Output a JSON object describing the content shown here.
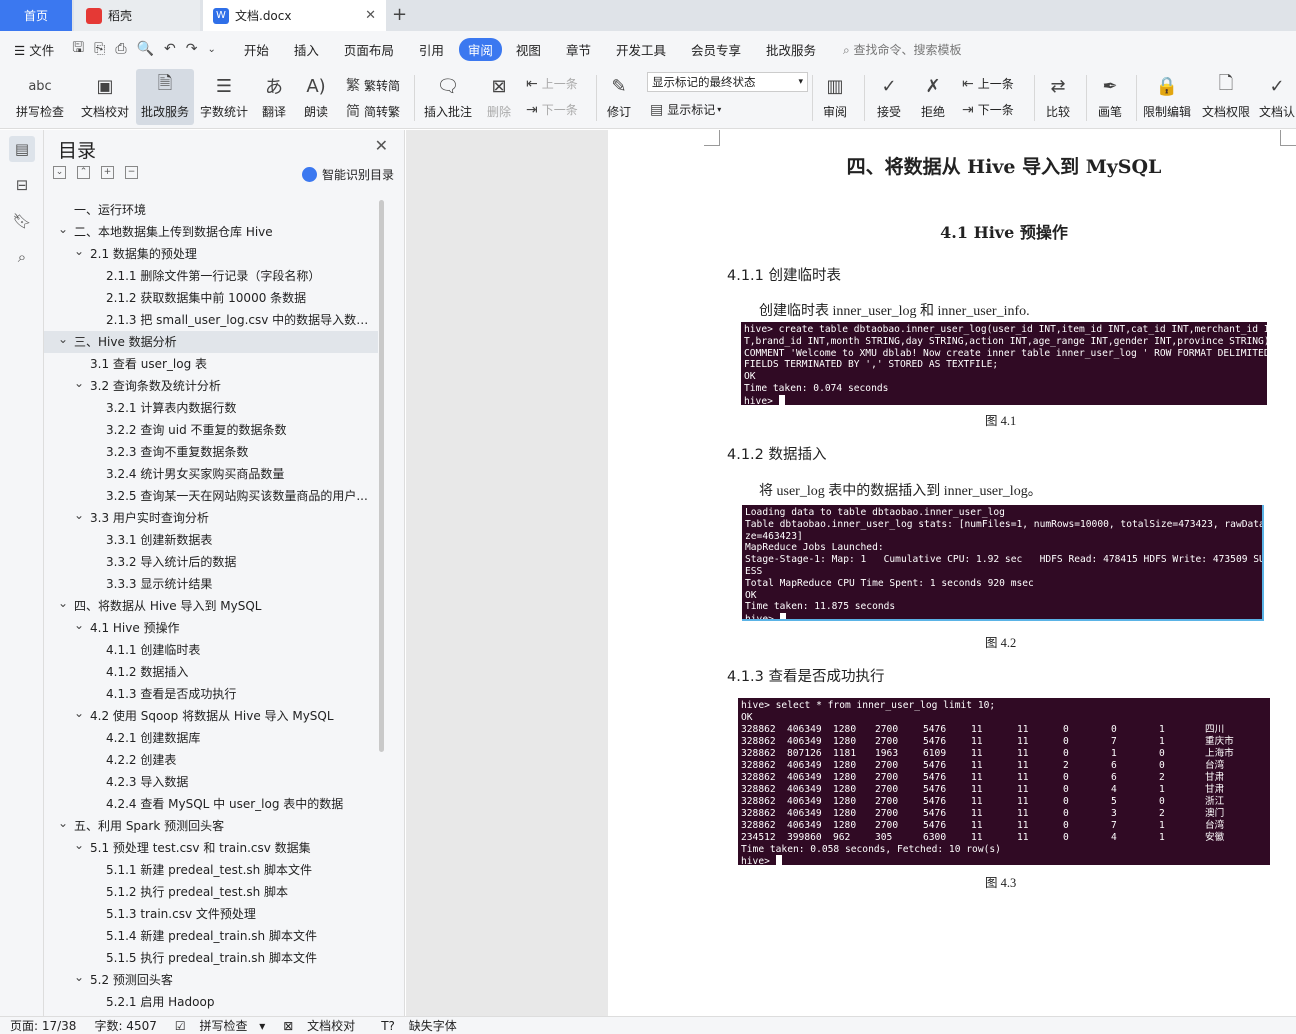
{
  "tabs": [
    {
      "label": "首页"
    },
    {
      "label": "稻壳"
    },
    {
      "label": "文档.docx"
    }
  ],
  "menu": {
    "file": "文件",
    "items": [
      "开始",
      "插入",
      "页面布局",
      "引用",
      "审阅",
      "视图",
      "章节",
      "开发工具",
      "会员专享",
      "批改服务"
    ],
    "active": "审阅",
    "search_placeholder": "查找命令、搜索模板"
  },
  "ribbon": {
    "spellcheck": "拼写检查",
    "doc_proof": "文档校对",
    "review_service": "批改服务",
    "word_count": "字数统计",
    "translate": "翻译",
    "read_aloud": "朗读",
    "to_traditional": "繁转简",
    "to_simplified": "简转繁",
    "insert_comment": "插入批注",
    "delete": "删除",
    "prev_top": "上一条",
    "next_top": "下一条",
    "track": "修订",
    "markup_state": "显示标记的最终状态",
    "show_markup": "显示标记",
    "review": "审阅",
    "accept": "接受",
    "reject": "拒绝",
    "prev": "上一条",
    "next": "下一条",
    "compare": "比较",
    "pen": "画笔",
    "restrict": "限制编辑",
    "doc_rights": "文档权限",
    "doc_cert": "文档认"
  },
  "toc": {
    "title": "目录",
    "smart": "智能识别目录",
    "items": [
      {
        "text": "一、运行环境",
        "level": 1,
        "toggle": ""
      },
      {
        "text": "二、本地数据集上传到数据仓库 Hive",
        "level": 1,
        "toggle": "v"
      },
      {
        "text": "2.1  数据集的预处理",
        "level": 2,
        "toggle": "v"
      },
      {
        "text": "2.1.1  删除文件第一行记录（字段名称）",
        "level": 3,
        "toggle": ""
      },
      {
        "text": "2.1.2  获取数据集中前 10000 条数据",
        "level": 3,
        "toggle": ""
      },
      {
        "text": "2.1.3  把 small_user_log.csv 中的数据导入数据...",
        "level": 3,
        "toggle": ""
      },
      {
        "text": "三、Hive 数据分析",
        "level": 1,
        "toggle": "v",
        "selected": true
      },
      {
        "text": "3.1  查看 user_log 表",
        "level": 2,
        "toggle": ""
      },
      {
        "text": "3.2  查询条数及统计分析",
        "level": 2,
        "toggle": "v"
      },
      {
        "text": "3.2.1  计算表内数据行数",
        "level": 3,
        "toggle": ""
      },
      {
        "text": "3.2.2  查询 uid 不重复的数据条数",
        "level": 3,
        "toggle": ""
      },
      {
        "text": "3.2.3  查询不重复数据条数",
        "level": 3,
        "toggle": ""
      },
      {
        "text": "3.2.4  统计男女买家购买商品数量",
        "level": 3,
        "toggle": ""
      },
      {
        "text": "3.2.5  查询某一天在网站购买该数量商品的用户...",
        "level": 3,
        "toggle": ""
      },
      {
        "text": "3.3  用户实时查询分析",
        "level": 2,
        "toggle": "v"
      },
      {
        "text": "3.3.1  创建新数据表",
        "level": 3,
        "toggle": ""
      },
      {
        "text": "3.3.2  导入统计后的数据",
        "level": 3,
        "toggle": ""
      },
      {
        "text": "3.3.3  显示统计结果",
        "level": 3,
        "toggle": ""
      },
      {
        "text": "四、将数据从 Hive 导入到 MySQL",
        "level": 1,
        "toggle": "v"
      },
      {
        "text": "4.1 Hive 预操作",
        "level": 2,
        "toggle": "v"
      },
      {
        "text": "4.1.1  创建临时表",
        "level": 3,
        "toggle": ""
      },
      {
        "text": "4.1.2  数据插入",
        "level": 3,
        "toggle": ""
      },
      {
        "text": "4.1.3  查看是否成功执行",
        "level": 3,
        "toggle": ""
      },
      {
        "text": "4.2  使用 Sqoop 将数据从 Hive 导入 MySQL",
        "level": 2,
        "toggle": "v"
      },
      {
        "text": "4.2.1  创建数据库",
        "level": 3,
        "toggle": ""
      },
      {
        "text": "4.2.2  创建表",
        "level": 3,
        "toggle": ""
      },
      {
        "text": "4.2.3  导入数据",
        "level": 3,
        "toggle": ""
      },
      {
        "text": "4.2.4  查看 MySQL 中 user_log 表中的数据",
        "level": 3,
        "toggle": ""
      },
      {
        "text": "五、利用 Spark 预测回头客",
        "level": 1,
        "toggle": "v"
      },
      {
        "text": "5.1  预处理 test.csv 和 train.csv 数据集",
        "level": 2,
        "toggle": "v"
      },
      {
        "text": "5.1.1  新建 predeal_test.sh 脚本文件",
        "level": 3,
        "toggle": ""
      },
      {
        "text": "5.1.2  执行 predeal_test.sh 脚本",
        "level": 3,
        "toggle": ""
      },
      {
        "text": "5.1.3 train.csv 文件预处理",
        "level": 3,
        "toggle": ""
      },
      {
        "text": "5.1.4  新建 predeal_train.sh 脚本文件",
        "level": 3,
        "toggle": ""
      },
      {
        "text": "5.1.5  执行 predeal_train.sh 脚本文件",
        "level": 3,
        "toggle": ""
      },
      {
        "text": "5.2  预测回头客",
        "level": 2,
        "toggle": "v"
      },
      {
        "text": "5.2.1  启用 Hadoop",
        "level": 3,
        "toggle": ""
      }
    ]
  },
  "doc": {
    "h1": "四、将数据从 Hive 导入到 MySQL",
    "h2": "4.1 Hive 预操作",
    "s1": "4.1.1  创建临时表",
    "p1": "创建临时表 inner_user_log 和 inner_user_info.",
    "term1": "hive> create table dbtaobao.inner_user_log(user_id INT,item_id INT,cat_id INT,merchant_id I\nT,brand_id INT,month STRING,day STRING,action INT,age_range INT,gender INT,province STRING)\nCOMMENT 'Welcome to XMU dblab! Now create inner table inner_user_log ' ROW FORMAT DELIMITED\nFIELDS TERMINATED BY ',' STORED AS TEXTFILE;\nOK\nTime taken: 0.074 seconds\nhive> ",
    "cap1": "图 4.1",
    "s2": "4.1.2  数据插入",
    "p2": "将 user_log 表中的数据插入到 inner_user_log。",
    "term2": "Loading data to table dbtaobao.inner_user_log\nTable dbtaobao.inner_user_log stats: [numFiles=1, numRows=10000, totalSize=473423, rawDataSi\nze=463423]\nMapReduce Jobs Launched:\nStage-Stage-1: Map: 1   Cumulative CPU: 1.92 sec   HDFS Read: 478415 HDFS Write: 473509 SUCC\nESS\nTotal MapReduce CPU Time Spent: 1 seconds 920 msec\nOK\nTime taken: 11.875 seconds\nhive> ",
    "cap2": "图 4.2",
    "s3": "4.1.3  查看是否成功执行",
    "term3_head": "hive> select * from inner_user_log limit 10;\nOK",
    "term3_rows": [
      [
        "328862",
        "406349",
        "1280",
        "2700",
        "5476",
        "11",
        "11",
        "0",
        "0",
        "1",
        "四川"
      ],
      [
        "328862",
        "406349",
        "1280",
        "2700",
        "5476",
        "11",
        "11",
        "0",
        "7",
        "1",
        "重庆市"
      ],
      [
        "328862",
        "807126",
        "1181",
        "1963",
        "6109",
        "11",
        "11",
        "0",
        "1",
        "0",
        "上海市"
      ],
      [
        "328862",
        "406349",
        "1280",
        "2700",
        "5476",
        "11",
        "11",
        "2",
        "6",
        "0",
        "台湾"
      ],
      [
        "328862",
        "406349",
        "1280",
        "2700",
        "5476",
        "11",
        "11",
        "0",
        "6",
        "2",
        "甘肃"
      ],
      [
        "328862",
        "406349",
        "1280",
        "2700",
        "5476",
        "11",
        "11",
        "0",
        "4",
        "1",
        "甘肃"
      ],
      [
        "328862",
        "406349",
        "1280",
        "2700",
        "5476",
        "11",
        "11",
        "0",
        "5",
        "0",
        "浙江"
      ],
      [
        "328862",
        "406349",
        "1280",
        "2700",
        "5476",
        "11",
        "11",
        "0",
        "3",
        "2",
        "澳门"
      ],
      [
        "328862",
        "406349",
        "1280",
        "2700",
        "5476",
        "11",
        "11",
        "0",
        "7",
        "1",
        "台湾"
      ],
      [
        "234512",
        "399860",
        "962",
        "305",
        "6300",
        "11",
        "11",
        "0",
        "4",
        "1",
        "安徽"
      ]
    ],
    "term3_tail": "Time taken: 0.058 seconds, Fetched: 10 row(s)\nhive> ",
    "cap3": "图 4.3"
  },
  "status": {
    "page": "页面: 17/38",
    "words": "字数: 4507",
    "spell": "拼写检查",
    "proof": "文档校对",
    "missing_font": "缺失字体"
  }
}
